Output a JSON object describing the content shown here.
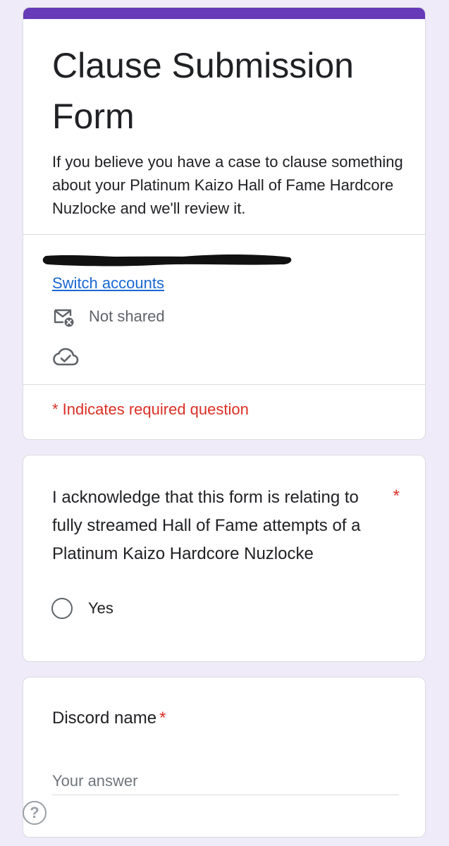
{
  "form": {
    "title": "Clause Submission Form",
    "description": "If you believe you have a case to clause something about your Platinum Kaizo Hall of Fame Hardcore Nuzlocke and we'll review it.",
    "accent_color": "#673ab7",
    "background_color": "#f0ebf8"
  },
  "account": {
    "switch_label": "Switch accounts",
    "email_status": "Not shared",
    "email_status_icon": "mail-not-shared-icon",
    "save_status_icon": "cloud-done-icon",
    "required_note": "* Indicates required question"
  },
  "questions": [
    {
      "text": "I acknowledge that this form is relating to fully streamed Hall of Fame attempts of a Platinum Kaizo Hardcore Nuzlocke",
      "required_mark": "*",
      "type": "radio",
      "options": [
        {
          "label": "Yes",
          "selected": false
        }
      ]
    },
    {
      "text": "Discord name",
      "required_mark": "*",
      "type": "short-answer",
      "placeholder": "Your answer",
      "value": ""
    }
  ],
  "help": {
    "label": "?"
  },
  "colors": {
    "required": "#d93025",
    "link": "#1967d2"
  }
}
